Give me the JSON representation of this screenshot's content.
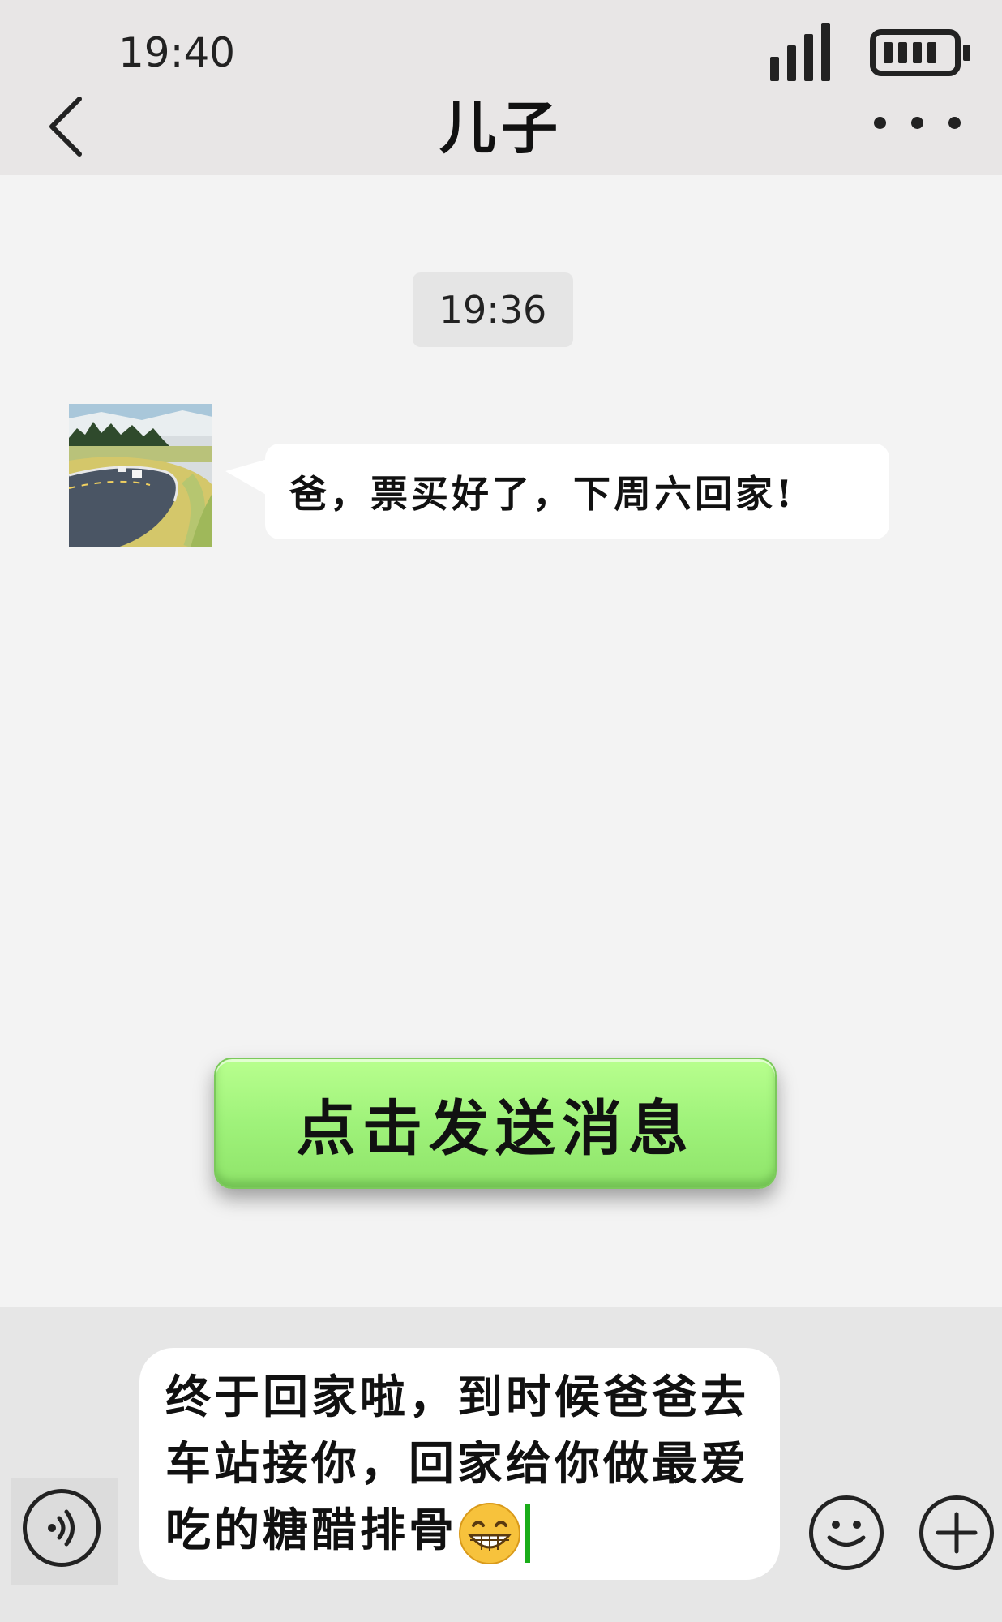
{
  "status_bar": {
    "time": "19:40"
  },
  "header": {
    "title": "儿子"
  },
  "chat": {
    "timestamp": "19:36",
    "messages": [
      {
        "sender": "contact",
        "text": "爸，票买好了，下周六回家!"
      }
    ]
  },
  "send_button": {
    "label": "点击发送消息",
    "color": "#9ff27a"
  },
  "input": {
    "value": "终于回家啦，到时候爸爸去车站接你，回家给你做最爱吃的糖醋排骨",
    "emoji": "grinning-face",
    "caret_color": "#1aad19"
  },
  "icons": [
    "back-chevron-icon",
    "more-dots-icon",
    "signal-icon",
    "battery-icon",
    "voice-icon",
    "emoji-icon",
    "plus-icon"
  ]
}
